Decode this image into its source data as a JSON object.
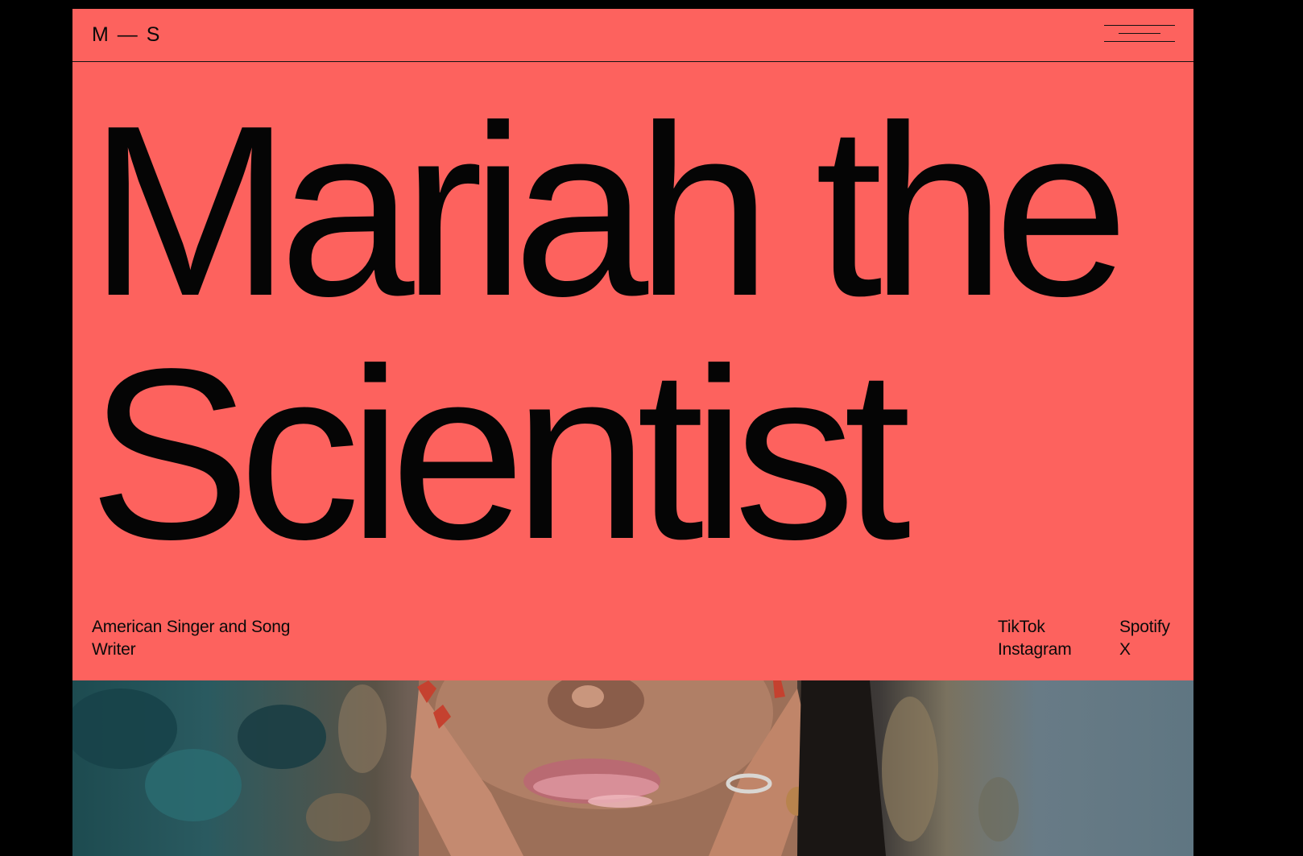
{
  "header": {
    "logo_text": "M — S",
    "menu_icon": "hamburger-menu-icon"
  },
  "hero": {
    "title_line1": "Mariah the",
    "title_line2": "Scientist"
  },
  "footer_info": {
    "tagline": "American Singer and Song Writer",
    "social_col1": [
      "TikTok",
      "Instagram"
    ],
    "social_col2": [
      "Spotify",
      "X"
    ]
  },
  "photo": {
    "subject": "portrait-photo"
  },
  "colors": {
    "background": "#000000",
    "accent": "#fd625e",
    "text": "#0a0a0a"
  }
}
